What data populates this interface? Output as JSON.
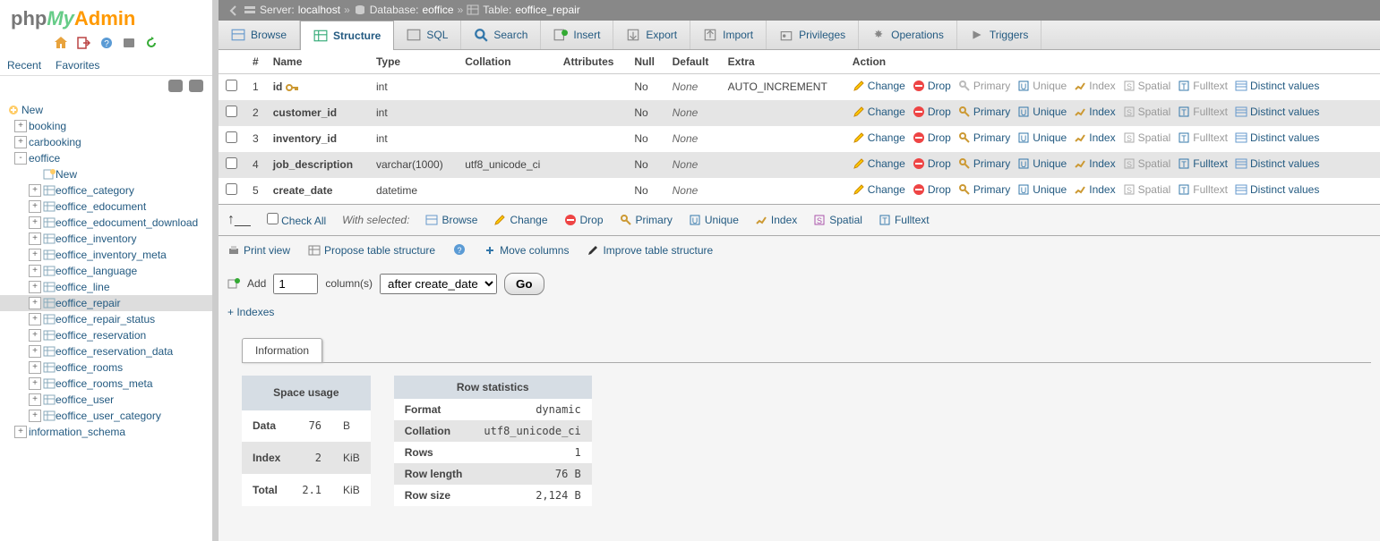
{
  "logo": {
    "p1": "php",
    "p2": "My",
    "p3": "Admin"
  },
  "recent_tabs": {
    "recent": "Recent",
    "favorites": "Favorites"
  },
  "tree": {
    "new": "New",
    "items": [
      {
        "label": "booking",
        "level": 1,
        "toggle": "+",
        "type": "db"
      },
      {
        "label": "carbooking",
        "level": 1,
        "toggle": "+",
        "type": "db"
      },
      {
        "label": "eoffice",
        "level": 1,
        "toggle": "-",
        "type": "db",
        "selected": false
      },
      {
        "label": "New",
        "level": 2,
        "toggle": "",
        "type": "new"
      },
      {
        "label": "eoffice_category",
        "level": 2,
        "toggle": "+",
        "type": "tbl"
      },
      {
        "label": "eoffice_edocument",
        "level": 2,
        "toggle": "+",
        "type": "tbl"
      },
      {
        "label": "eoffice_edocument_download",
        "level": 2,
        "toggle": "+",
        "type": "tbl"
      },
      {
        "label": "eoffice_inventory",
        "level": 2,
        "toggle": "+",
        "type": "tbl"
      },
      {
        "label": "eoffice_inventory_meta",
        "level": 2,
        "toggle": "+",
        "type": "tbl"
      },
      {
        "label": "eoffice_language",
        "level": 2,
        "toggle": "+",
        "type": "tbl"
      },
      {
        "label": "eoffice_line",
        "level": 2,
        "toggle": "+",
        "type": "tbl"
      },
      {
        "label": "eoffice_repair",
        "level": 2,
        "toggle": "+",
        "type": "tbl",
        "selected": true
      },
      {
        "label": "eoffice_repair_status",
        "level": 2,
        "toggle": "+",
        "type": "tbl"
      },
      {
        "label": "eoffice_reservation",
        "level": 2,
        "toggle": "+",
        "type": "tbl"
      },
      {
        "label": "eoffice_reservation_data",
        "level": 2,
        "toggle": "+",
        "type": "tbl"
      },
      {
        "label": "eoffice_rooms",
        "level": 2,
        "toggle": "+",
        "type": "tbl"
      },
      {
        "label": "eoffice_rooms_meta",
        "level": 2,
        "toggle": "+",
        "type": "tbl"
      },
      {
        "label": "eoffice_user",
        "level": 2,
        "toggle": "+",
        "type": "tbl"
      },
      {
        "label": "eoffice_user_category",
        "level": 2,
        "toggle": "+",
        "type": "tbl"
      },
      {
        "label": "information_schema",
        "level": 1,
        "toggle": "+",
        "type": "db"
      }
    ]
  },
  "breadcrumb": {
    "server_lbl": "Server:",
    "server": "localhost",
    "database_lbl": "Database:",
    "database": "eoffice",
    "table_lbl": "Table:",
    "table": "eoffice_repair",
    "sep": "»"
  },
  "tabs": [
    {
      "label": "Browse"
    },
    {
      "label": "Structure"
    },
    {
      "label": "SQL"
    },
    {
      "label": "Search"
    },
    {
      "label": "Insert"
    },
    {
      "label": "Export"
    },
    {
      "label": "Import"
    },
    {
      "label": "Privileges"
    },
    {
      "label": "Operations"
    },
    {
      "label": "Triggers"
    }
  ],
  "struct": {
    "headers": {
      "num": "#",
      "name": "Name",
      "type": "Type",
      "collation": "Collation",
      "attributes": "Attributes",
      "null": "Null",
      "default": "Default",
      "extra": "Extra",
      "action": "Action"
    },
    "rows": [
      {
        "num": "1",
        "name": "id",
        "key": true,
        "type": "int",
        "collation": "",
        "attributes": "",
        "null": "No",
        "default": "None",
        "extra": "AUTO_INCREMENT",
        "pk": true
      },
      {
        "num": "2",
        "name": "customer_id",
        "key": false,
        "type": "int",
        "collation": "",
        "attributes": "",
        "null": "No",
        "default": "None",
        "extra": "",
        "pk": false
      },
      {
        "num": "3",
        "name": "inventory_id",
        "key": false,
        "type": "int",
        "collation": "",
        "attributes": "",
        "null": "No",
        "default": "None",
        "extra": "",
        "pk": false
      },
      {
        "num": "4",
        "name": "job_description",
        "key": false,
        "type": "varchar(1000)",
        "collation": "utf8_unicode_ci",
        "attributes": "",
        "null": "No",
        "default": "None",
        "extra": "",
        "pk": false
      },
      {
        "num": "5",
        "name": "create_date",
        "key": false,
        "type": "datetime",
        "collation": "",
        "attributes": "",
        "null": "No",
        "default": "None",
        "extra": "",
        "pk": false
      }
    ],
    "actions": {
      "change": "Change",
      "drop": "Drop",
      "primary": "Primary",
      "unique": "Unique",
      "index": "Index",
      "spatial": "Spatial",
      "fulltext": "Fulltext",
      "distinct": "Distinct values"
    }
  },
  "withsel": {
    "checkall": "Check All",
    "withsel": "With selected:",
    "browse": "Browse",
    "change": "Change",
    "drop": "Drop",
    "primary": "Primary",
    "unique": "Unique",
    "index": "Index",
    "spatial": "Spatial",
    "fulltext": "Fulltext"
  },
  "subtoolbar": {
    "print": "Print view",
    "propose": "Propose table structure",
    "move": "Move columns",
    "improve": "Improve table structure"
  },
  "addrow": {
    "add": "Add",
    "value": "1",
    "cols": "column(s)",
    "after": "after create_date",
    "go": "Go"
  },
  "indexes": "+ Indexes",
  "info": {
    "tab": "Information",
    "space": {
      "title": "Space usage",
      "rows": [
        {
          "l": "Data",
          "n": "76",
          "u": "B"
        },
        {
          "l": "Index",
          "n": "2",
          "u": "KiB"
        },
        {
          "l": "Total",
          "n": "2.1",
          "u": "KiB"
        }
      ]
    },
    "stats": {
      "title": "Row statistics",
      "rows": [
        {
          "l": "Format",
          "v": "dynamic"
        },
        {
          "l": "Collation",
          "v": "utf8_unicode_ci"
        },
        {
          "l": "Rows",
          "v": "1"
        },
        {
          "l": "Row length",
          "v": "76 B"
        },
        {
          "l": "Row size",
          "v": "2,124 B"
        }
      ]
    }
  }
}
